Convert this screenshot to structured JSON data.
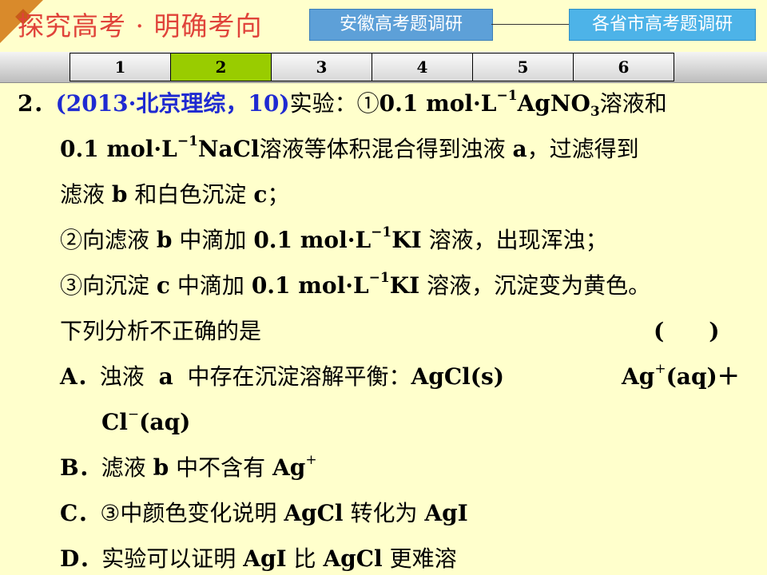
{
  "header": {
    "title": "探究高考 · 明确考向",
    "nav_buttons": [
      "安徽高考题调研",
      "各省市高考题调研"
    ]
  },
  "tabs": {
    "items": [
      "1",
      "2",
      "3",
      "4",
      "5",
      "6"
    ],
    "active_index": 1,
    "active_color": "#99CC00"
  },
  "question": {
    "number": "2．",
    "source": "(2013·北京理综，10)",
    "lines": [
      {
        "parts": [
          "实验：①",
          "0.1 mol·L",
          "−1",
          "AgNO",
          "3",
          "溶液和"
        ]
      },
      {
        "parts": [
          "0.1 mol·L",
          "−1",
          "NaCl",
          "溶液等体积混合得到浊液",
          "a",
          "，过滤得到"
        ]
      },
      {
        "parts": [
          "滤液",
          "b",
          "和白色沉淀",
          "c",
          "；"
        ]
      },
      {
        "parts": [
          "②向滤液",
          "b",
          "中滴加",
          "0.1 mol·L",
          "−1",
          "KI",
          "溶液，出现浑浊；"
        ]
      },
      {
        "parts": [
          "③向沉淀",
          "c",
          "中滴加",
          "0.1 mol·L",
          "−1",
          "KI",
          "溶液，沉淀变为黄色。"
        ]
      },
      {
        "parts": [
          "下列分析不正确的是",
          "(　　)"
        ]
      }
    ],
    "options": [
      {
        "label": "A．",
        "parts": [
          "浊液",
          "a",
          "中存在沉淀溶解平衡：",
          "AgCl(s)",
          "Ag",
          "+",
          "(aq)＋"
        ],
        "cont": [
          "Cl",
          "−",
          "(aq)"
        ]
      },
      {
        "label": "B．",
        "parts": [
          "滤液",
          "b",
          "中不含有",
          "Ag",
          "+"
        ]
      },
      {
        "label": "C．",
        "parts": [
          "③中颜色变化说明",
          "AgCl",
          "转化为",
          "AgI"
        ]
      },
      {
        "label": "D．",
        "parts": [
          "实验可以证明",
          "AgI",
          "比",
          "AgCl",
          "更难溶"
        ]
      }
    ]
  }
}
